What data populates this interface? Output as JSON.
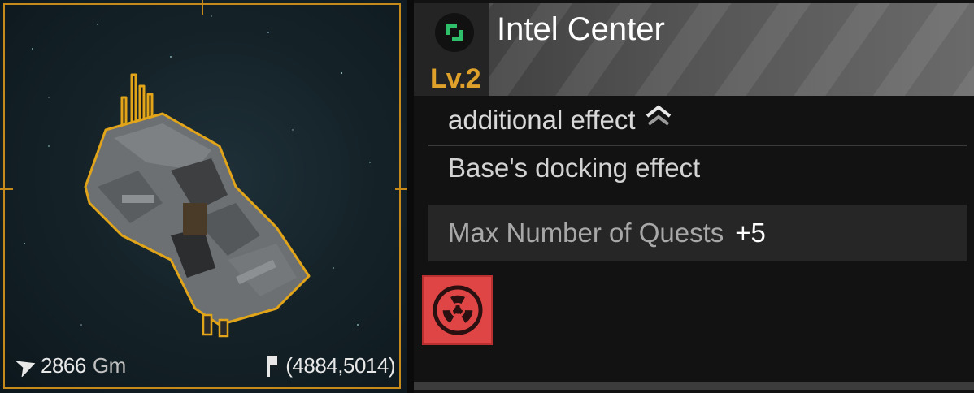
{
  "viewport": {
    "distance_value": "2866",
    "distance_unit": "Gm",
    "coordinates": "(4884,5014)"
  },
  "building": {
    "title": "Intel Center",
    "level": "Lv.2",
    "type_icon": "green-square-icon"
  },
  "effects": {
    "section_label": "additional effect",
    "section_toggle_icon": "double-chevron-up-icon",
    "subheading": "Base's docking effect",
    "rows": [
      {
        "name": "Max Number of Quests",
        "value": "+5"
      }
    ]
  },
  "actions": {
    "hazard_button_icon": "radiation-icon"
  },
  "colors": {
    "frame": "#c68a1a",
    "level": "#e0a12b",
    "icon_green": "#2fbf6a",
    "hazard_button": "#e04545"
  }
}
